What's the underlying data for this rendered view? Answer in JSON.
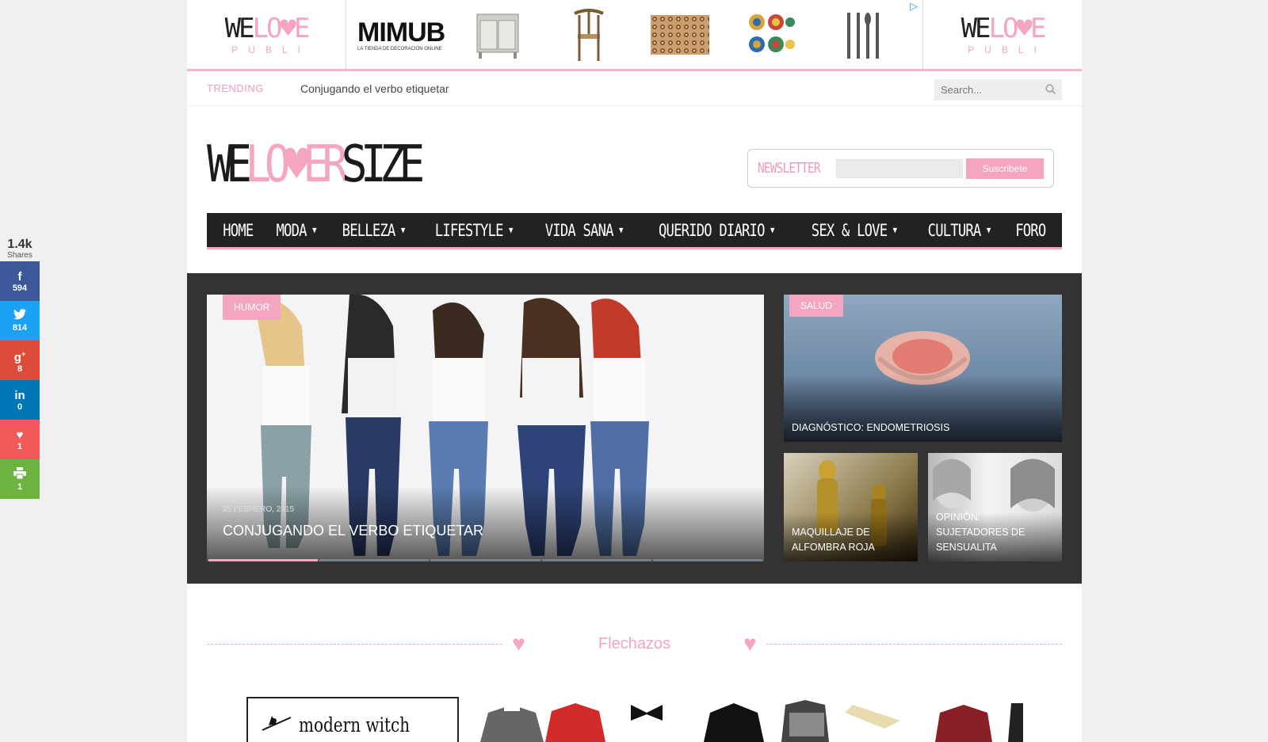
{
  "share": {
    "total": "1.4k",
    "label": "Shares",
    "buttons": [
      {
        "name": "facebook",
        "icon": "f",
        "count": "594",
        "color": "#3b5998"
      },
      {
        "name": "twitter",
        "icon": "t",
        "count": "814",
        "color": "#1da1f2"
      },
      {
        "name": "googleplus",
        "icon": "g+",
        "count": "8",
        "color": "#dd4b39"
      },
      {
        "name": "linkedin",
        "icon": "in",
        "count": "0",
        "color": "#0077b5"
      },
      {
        "name": "love",
        "icon": "heart",
        "count": "1",
        "color": "#f25a5a"
      },
      {
        "name": "print",
        "icon": "print",
        "count": "1",
        "color": "#6db33f"
      }
    ]
  },
  "ad": {
    "logo_left": "WE",
    "logo_pink": "LO♥E",
    "logo_sub": "PUBLI",
    "brand": "MIMUB",
    "brand_tag": "LA TIENDA DE DECORACIÓN ONLINE"
  },
  "trending": {
    "label": "TRENDING",
    "text": "Conjugando el verbo etiquetar"
  },
  "search": {
    "placeholder": "Search..."
  },
  "logo": {
    "we": "WE",
    "love": "LO♥ER",
    "size": "SIZE"
  },
  "newsletter": {
    "label": "NEWSLETTER",
    "button": "Suscribete"
  },
  "nav": [
    {
      "label": "HOME",
      "dropdown": false
    },
    {
      "label": "MODA",
      "dropdown": true
    },
    {
      "label": "BELLEZA",
      "dropdown": true
    },
    {
      "label": "LIFESTYLE",
      "dropdown": true
    },
    {
      "label": "VIDA SANA",
      "dropdown": true
    },
    {
      "label": "QUERIDO DIARIO",
      "dropdown": true
    },
    {
      "label": "SEX & LOVE",
      "dropdown": true
    },
    {
      "label": "CULTURA",
      "dropdown": true
    },
    {
      "label": "FORO",
      "dropdown": false
    }
  ],
  "featured": {
    "main": {
      "category": "HUMOR",
      "date": "25 FEBRERO, 2015",
      "title": "CONJUGANDO EL VERBO ETIQUETAR"
    },
    "side_top": {
      "category": "SALUD",
      "title": "DIAGNÓSTICO: ENDOMETRIOSIS"
    },
    "side_left": {
      "title": "MAQUILLAJE DE ALFOMBRA ROJA"
    },
    "side_right": {
      "title": "OPINIÓN: SUJETADORES DE SENSUALITA"
    }
  },
  "section": {
    "title": "Flechazos"
  },
  "strip": {
    "witch": "modern witch"
  },
  "colors": {
    "pink": "#f4a5c1",
    "dark": "#222222",
    "featured_bg": "#333333"
  }
}
